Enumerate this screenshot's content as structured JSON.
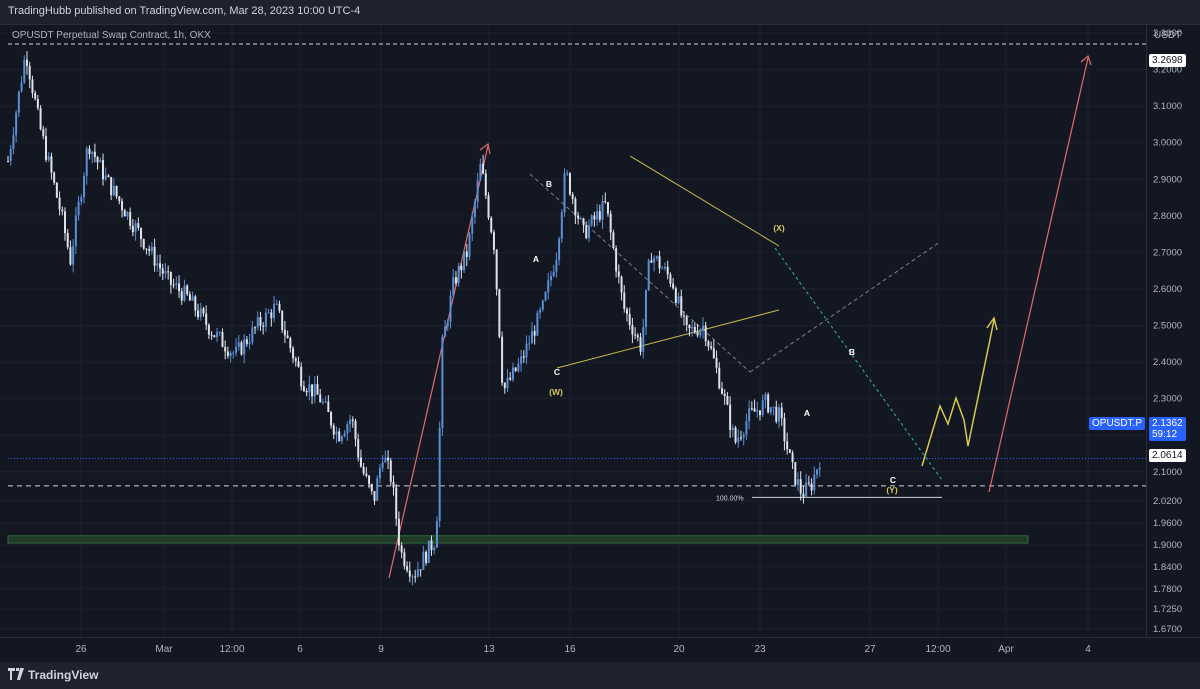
{
  "header": {
    "published": "TradingHubb published on TradingView.com, Mar 28, 2023 10:00 UTC-4"
  },
  "symbol_label": "OPUSDT Perpetual Swap Contract, 1h, OKX",
  "axis_unit": "USDT",
  "footer": {
    "brand": "TradingView"
  },
  "price_labels": {
    "top": "3.2698",
    "current_symbol": "OPUSDT.P",
    "current_price": "2.1362",
    "countdown": "59:12",
    "level": "2.0614"
  },
  "annotations": {
    "fib": "100.00%",
    "waves": [
      "B",
      "A",
      "C",
      "(W)",
      "(X)",
      "A",
      "B",
      "C",
      "(Y)"
    ]
  },
  "colors": {
    "candle": "#5b8fd6",
    "candle_light": "#dfe3ea",
    "arrow_red": "#e06b6b",
    "triangle_yellow": "#c8b84a",
    "projection_yellow": "#d6c84e",
    "channel_cyan": "#2fb3b3",
    "zone_green": "#2e6b3c",
    "current_tag": "#2962ff"
  },
  "chart_data": {
    "type": "candlestick",
    "title": "OPUSDT Perpetual Swap Contract, 1h, OKX",
    "y_unit": "USDT",
    "ylim": [
      1.67,
      3.3
    ],
    "y_ticks": [
      "3.3000",
      "3.2000",
      "3.1000",
      "3.0000",
      "2.9000",
      "2.8000",
      "2.7000",
      "2.6000",
      "2.5000",
      "2.4000",
      "2.3000",
      "2.2000",
      "2.1000",
      "2.0200",
      "1.9600",
      "1.9000",
      "1.8400",
      "1.7800",
      "1.7250",
      "1.6700"
    ],
    "x_ticks": [
      "26",
      "Mar",
      "12:00",
      "6",
      "9",
      "13",
      "16",
      "20",
      "23",
      "27",
      "12:00",
      "Apr",
      "4"
    ],
    "price_path": [
      [
        0,
        2.95
      ],
      [
        0.02,
        3.25
      ],
      [
        0.035,
        3.05
      ],
      [
        0.06,
        2.8
      ],
      [
        0.07,
        2.68
      ],
      [
        0.09,
        3.0
      ],
      [
        0.11,
        2.9
      ],
      [
        0.13,
        2.82
      ],
      [
        0.155,
        2.72
      ],
      [
        0.18,
        2.62
      ],
      [
        0.2,
        2.58
      ],
      [
        0.23,
        2.48
      ],
      [
        0.255,
        2.42
      ],
      [
        0.28,
        2.5
      ],
      [
        0.3,
        2.55
      ],
      [
        0.315,
        2.45
      ],
      [
        0.33,
        2.35
      ],
      [
        0.35,
        2.3
      ],
      [
        0.37,
        2.2
      ],
      [
        0.385,
        2.25
      ],
      [
        0.395,
        2.12
      ],
      [
        0.41,
        2.02
      ],
      [
        0.42,
        2.15
      ],
      [
        0.43,
        2.08
      ],
      [
        0.44,
        1.88
      ],
      [
        0.455,
        1.82
      ],
      [
        0.465,
        1.86
      ],
      [
        0.48,
        1.92
      ],
      [
        0.487,
        2.45
      ],
      [
        0.5,
        2.62
      ],
      [
        0.515,
        2.7
      ],
      [
        0.53,
        2.94
      ],
      [
        0.545,
        2.72
      ],
      [
        0.555,
        2.32
      ],
      [
        0.575,
        2.4
      ],
      [
        0.6,
        2.55
      ],
      [
        0.615,
        2.7
      ],
      [
        0.625,
        2.92
      ],
      [
        0.645,
        2.75
      ],
      [
        0.67,
        2.83
      ],
      [
        0.69,
        2.55
      ],
      [
        0.71,
        2.44
      ],
      [
        0.72,
        2.7
      ],
      [
        0.745,
        2.62
      ],
      [
        0.76,
        2.48
      ],
      [
        0.78,
        2.5
      ],
      [
        0.8,
        2.33
      ],
      [
        0.815,
        2.18
      ],
      [
        0.83,
        2.25
      ],
      [
        0.85,
        2.29
      ],
      [
        0.865,
        2.25
      ],
      [
        0.88,
        2.1
      ],
      [
        0.89,
        2.04
      ],
      [
        0.9,
        2.06
      ],
      [
        0.91,
        2.136
      ]
    ],
    "lines": {
      "top_dashed": 3.2698,
      "level_dashed": 2.0614,
      "current_dotted": 2.1362,
      "fib_100": 2.03
    },
    "zone": [
      1.905,
      1.925
    ],
    "projection_path": [
      2.05,
      2.14,
      2.2,
      2.12,
      2.19,
      2.1,
      2.42
    ]
  }
}
